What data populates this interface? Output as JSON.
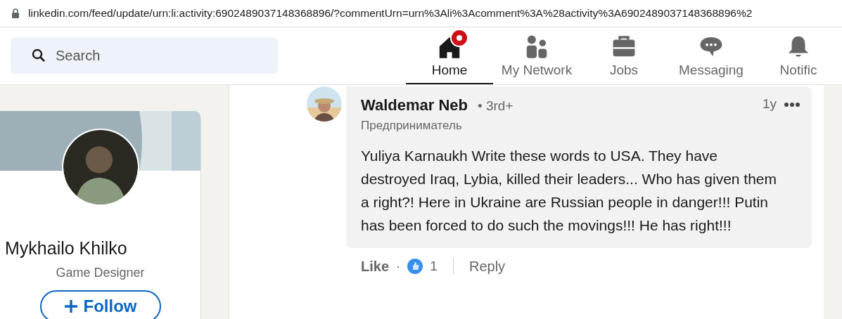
{
  "address_bar": {
    "url": "linkedin.com/feed/update/urn:li:activity:6902489037148368896/?commentUrn=urn%3Ali%3Acomment%3A%28activity%3A6902489037148368896%2"
  },
  "search": {
    "placeholder": "Search"
  },
  "nav": [
    {
      "label": "Home",
      "kind": "home",
      "selected": true,
      "badge": true
    },
    {
      "label": "My Network",
      "kind": "network",
      "selected": false,
      "badge": false
    },
    {
      "label": "Jobs",
      "kind": "jobs",
      "selected": false,
      "badge": false
    },
    {
      "label": "Messaging",
      "kind": "messaging",
      "selected": false,
      "badge": false
    },
    {
      "label": "Notific",
      "kind": "bell",
      "selected": false,
      "badge": false
    }
  ],
  "profile": {
    "name": "Mykhailo Khilko",
    "headline": "Game Designer",
    "follow_button": "Follow"
  },
  "comment": {
    "author": "Waldemar Neb",
    "degree": "• 3rd+",
    "headline": "Предприниматель",
    "time": "1y",
    "text": "Yuliya Karnaukh Write these words to USA. They have destroyed Iraq, Lybia, killed their leaders... Who has given them a right?! Here in Ukraine are Russian people in danger!!! Putin has been forced to do such the movings!!! He has right!!!",
    "like": "Like",
    "dot": "·",
    "reaction_count": "1",
    "reply": "Reply"
  }
}
